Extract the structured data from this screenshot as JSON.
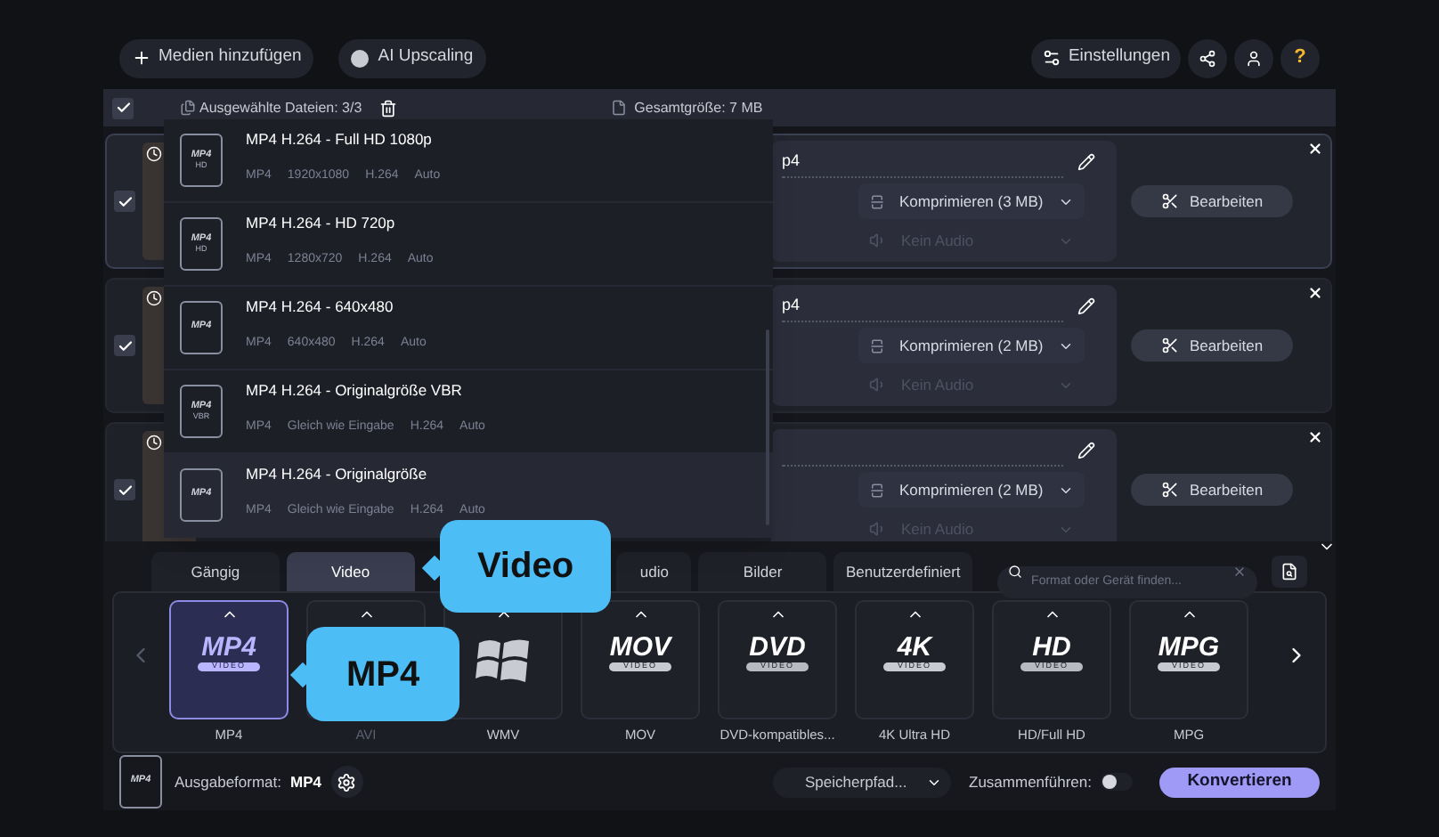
{
  "toolbar": {
    "add_media": "Medien hinzufügen",
    "ai_upscaling": "AI Upscaling",
    "settings": "Einstellungen",
    "help": "?"
  },
  "selection_bar": {
    "checked": true,
    "selected_files": "Ausgewählte Dateien: 3/3",
    "total_size": "Gesamtgröße: 7 MB"
  },
  "files": [
    {
      "checked": true,
      "name": "p4",
      "compression": "Komprimieren (3 MB)",
      "audio": "Kein Audio",
      "audio_disabled": true,
      "edit": "Bearbeiten",
      "selected": true
    },
    {
      "checked": true,
      "name": "p4",
      "compression": "Komprimieren (2 MB)",
      "audio": "Kein Audio",
      "audio_disabled": true,
      "edit": "Bearbeiten",
      "selected": false
    },
    {
      "checked": true,
      "compression": "Komprimieren (2 MB)",
      "audio": "Kein Audio",
      "audio_disabled": true,
      "edit": "Bearbeiten",
      "selected": false
    }
  ],
  "preset_menu": {
    "items": [
      {
        "title": "MP4 H.264 - Full HD 1080p",
        "badge": "MP4",
        "sub_badge": "HD",
        "specs": [
          "MP4",
          "1920x1080",
          "H.264",
          "Auto"
        ],
        "selected": false
      },
      {
        "title": "MP4 H.264 - HD 720p",
        "badge": "MP4",
        "sub_badge": "HD",
        "specs": [
          "MP4",
          "1280x720",
          "H.264",
          "Auto"
        ],
        "selected": false
      },
      {
        "title": "MP4 H.264 - 640x480",
        "badge": "MP4",
        "specs": [
          "MP4",
          "640x480",
          "H.264",
          "Auto"
        ],
        "selected": false
      },
      {
        "title": "MP4 H.264 - Originalgröße VBR",
        "badge": "MP4",
        "sub_badge": "VBR",
        "specs": [
          "MP4",
          "Gleich wie Eingabe",
          "H.264",
          "Auto"
        ],
        "selected": false
      },
      {
        "title": "MP4 H.264 - Originalgröße",
        "badge": "MP4",
        "specs": [
          "MP4",
          "Gleich wie Eingabe",
          "H.264",
          "Auto"
        ],
        "selected": true
      }
    ]
  },
  "tabs": [
    {
      "label": "Gängig",
      "selected": false
    },
    {
      "label": "Video",
      "selected": true
    },
    {
      "label": "udio",
      "selected": false
    },
    {
      "label": "Bilder",
      "selected": false
    },
    {
      "label": "Benutzerdefiniert",
      "selected": false
    }
  ],
  "search": {
    "placeholder": "Format oder Gerät finden..."
  },
  "formats": [
    {
      "label": "MP4",
      "kind": "text-logo",
      "logo": "MP4",
      "logo_sub": "VIDEO",
      "selected": true
    },
    {
      "label": "AVI",
      "kind": "covered",
      "selected": false
    },
    {
      "label": "WMV",
      "kind": "windows",
      "selected": false
    },
    {
      "label": "MOV",
      "kind": "text-logo",
      "logo": "MOV",
      "logo_sub": "VIDEO",
      "selected": false
    },
    {
      "label": "DVD-kompatibles...",
      "kind": "disc-logo",
      "logo": "DVD",
      "logo_sub": "VIDEO",
      "selected": false
    },
    {
      "label": "4K Ultra HD",
      "kind": "text-logo",
      "logo": "4K",
      "logo_sub": "VIDEO",
      "selected": false
    },
    {
      "label": "HD/Full HD",
      "kind": "disc-logo",
      "logo": "HD",
      "logo_sub": "VIDEO",
      "selected": false
    },
    {
      "label": "MPG",
      "kind": "text-logo",
      "logo": "MPG",
      "logo_sub": "VIDEO",
      "selected": false
    }
  ],
  "callouts": [
    {
      "text": "Video"
    },
    {
      "text": "MP4"
    }
  ],
  "footer": {
    "file_icon_label": "MP4",
    "output_format_label": "Ausgabeformat:",
    "output_format": "MP4",
    "save_path": "Speicherpfad...",
    "merge_label": "Zusammenführen:",
    "merge_on": false,
    "convert": "Konvertieren"
  }
}
